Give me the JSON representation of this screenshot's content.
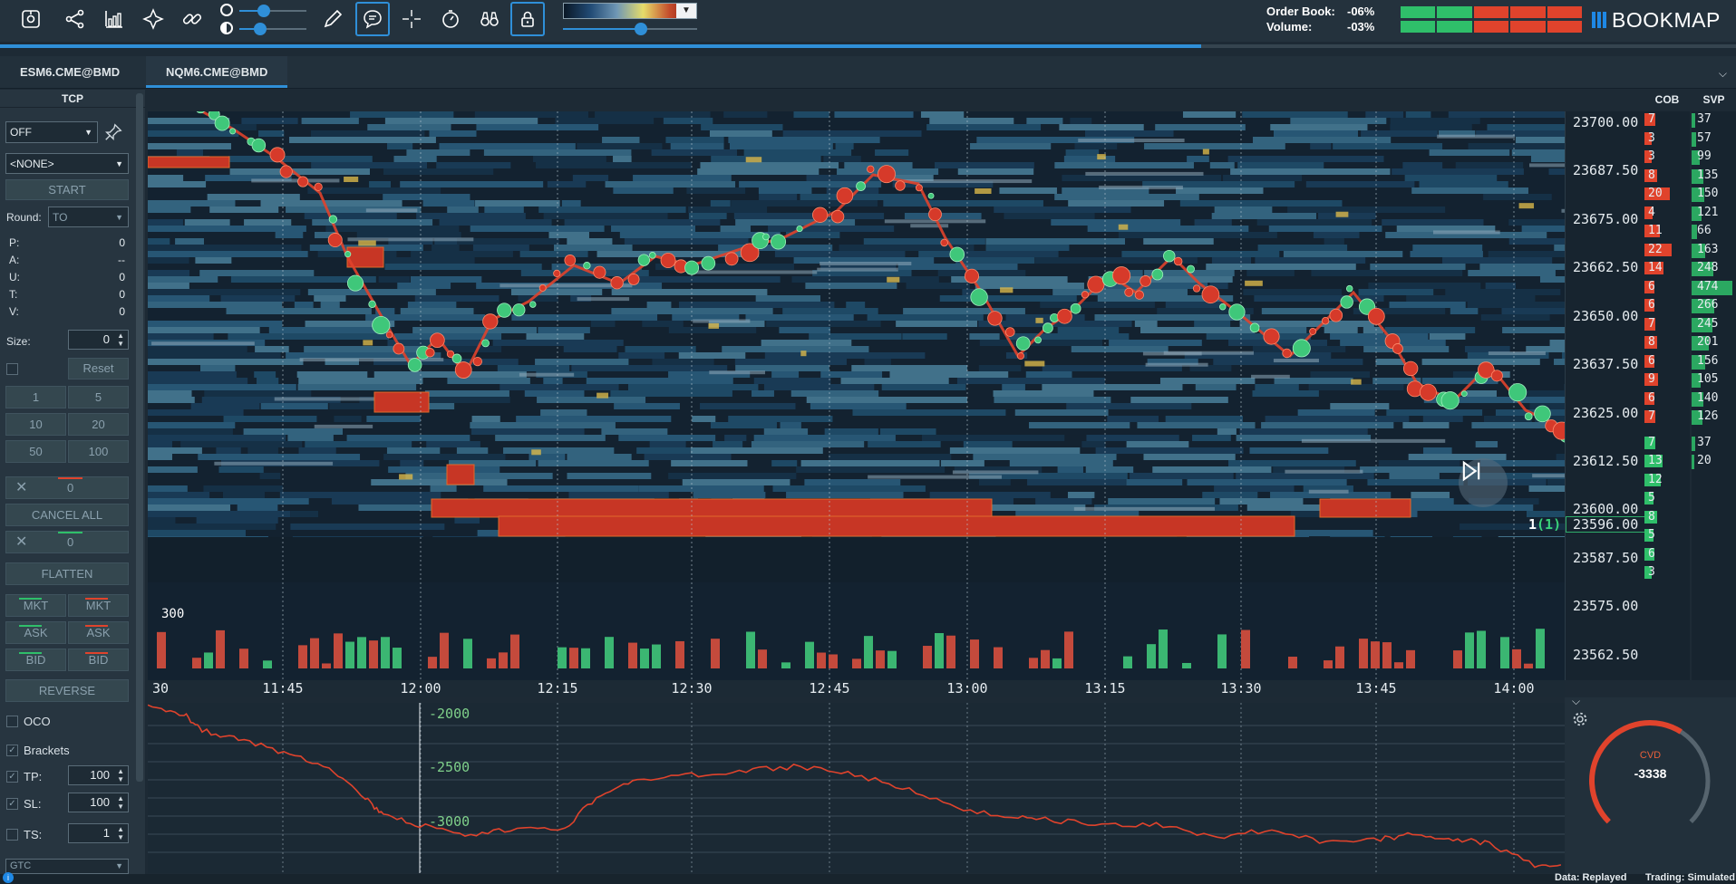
{
  "toolbar": {
    "icons": [
      "new-chart-icon",
      "connections-icon",
      "analytics-icon",
      "plugins-icon",
      "link-icon",
      "brightness-icon",
      "contrast-icon",
      "pencil-icon",
      "chat-icon",
      "crosshair-icon",
      "timer-icon",
      "binoculars-icon",
      "lock-icon"
    ],
    "replay_progress": 0.692
  },
  "hud": {
    "order_book_label": "Order Book:",
    "order_book_value": "-06%",
    "volume_label": "Volume:",
    "volume_value": "-03%",
    "brand": "BOOKMAP"
  },
  "tabs": [
    {
      "label": "ESM6.CME@BMD",
      "active": false
    },
    {
      "label": "NQM6.CME@BMD",
      "active": true
    }
  ],
  "tcp": {
    "title": "TCP",
    "mode": "OFF",
    "strategy": "<NONE>",
    "start_label": "START",
    "round_label": "Round:",
    "round_value": "TO",
    "stats": [
      {
        "label": "P:",
        "value": "0"
      },
      {
        "label": "A:",
        "value": "--"
      },
      {
        "label": "U:",
        "value": "0"
      },
      {
        "label": "T:",
        "value": "0"
      },
      {
        "label": "V:",
        "value": "0"
      }
    ],
    "size_label": "Size:",
    "size_value": "0",
    "reset_label": "Reset",
    "quick_sizes": [
      "1",
      "5",
      "10",
      "20",
      "50",
      "100"
    ],
    "buy_orders": "0",
    "cancel_all_label": "CANCEL ALL",
    "sell_orders": "0",
    "flatten_label": "FLATTEN",
    "order_buttons": [
      [
        "MKT",
        "MKT"
      ],
      [
        "ASK",
        "ASK"
      ],
      [
        "BID",
        "BID"
      ]
    ],
    "reverse_label": "REVERSE",
    "oco_label": "OCO",
    "brackets_label": "Brackets",
    "tp_label": "TP:",
    "tp_value": "100",
    "sl_label": "SL:",
    "sl_value": "100",
    "ts_label": "TS:",
    "ts_value": "1",
    "bottom_select": "GTC"
  },
  "chart": {
    "volume_scale_label": "300",
    "time_ticks": [
      "30",
      "11:45",
      "12:00",
      "12:15",
      "12:30",
      "12:45",
      "13:00",
      "13:15",
      "13:30",
      "13:45",
      "14:00"
    ],
    "price_ticks": [
      "23700.00",
      "23687.50",
      "23675.00",
      "23662.50",
      "23650.00",
      "23637.50",
      "23625.00",
      "23612.50",
      "23600.00",
      "23587.50",
      "23575.00",
      "23562.50"
    ],
    "last_price": "23596.00",
    "last_trade_size": "1",
    "last_trade_count": "(1)"
  },
  "cob": {
    "title": "COB",
    "ask_sizes": [
      "7",
      "3",
      "3",
      "8",
      "20",
      "4",
      "11",
      "22",
      "14",
      "6",
      "6",
      "7",
      "8",
      "6",
      "9",
      "6",
      "7"
    ],
    "bid_sizes": [
      "7",
      "13",
      "12",
      "5",
      "8",
      "5",
      "6",
      "3"
    ]
  },
  "svp": {
    "title": "SVP",
    "values": [
      "37",
      "57",
      "99",
      "135",
      "150",
      "121",
      "66",
      "163",
      "248",
      "474",
      "266",
      "245",
      "201",
      "156",
      "105",
      "140",
      "126",
      "37",
      "20"
    ]
  },
  "cvd": {
    "ticks": [
      "-2000",
      "-2500",
      "-3000"
    ],
    "gauge_title": "CVD",
    "gauge_value": "-3338",
    "gauge_fraction": 0.62
  },
  "status": {
    "data": "Data: Replayed",
    "trading": "Trading: Simulated"
  },
  "colors": {
    "accent": "#2f8fd8",
    "buy": "#2fbf6a",
    "sell": "#e0432c",
    "cvd_line": "#e0432c"
  }
}
